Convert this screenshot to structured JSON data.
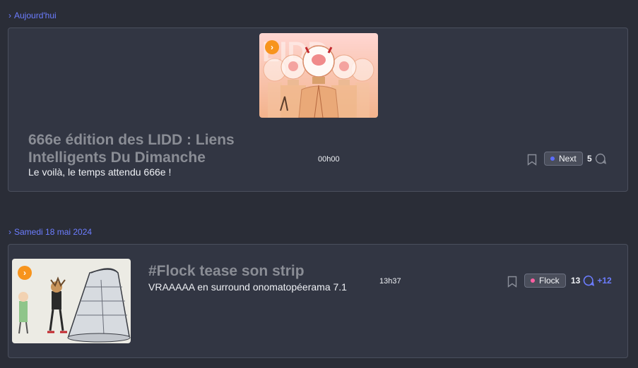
{
  "sections": [
    {
      "label": "Aujourd'hui",
      "article": {
        "title": "666e édition des LIDD : Liens Intelligents Du Dimanche",
        "subtitle": "Le voilà, le temps attendu 666e !",
        "time": "00h00",
        "tag": "Next",
        "tag_color": "#5b6cff",
        "comments": "5",
        "new_comments": ""
      }
    },
    {
      "label": "Samedi 18 mai 2024",
      "article": {
        "title": "#Flock tease son strip",
        "subtitle": "VRAAAAA en surround onomatopéerama 7.1",
        "time": "13h37",
        "tag": "Flock",
        "tag_color": "#ff5fa2",
        "comments": "13",
        "new_comments": "+12"
      }
    }
  ],
  "colors": {
    "accent": "#6c7dff",
    "badge": "#f7941d",
    "background": "#2a2d37",
    "card": "#323643"
  }
}
